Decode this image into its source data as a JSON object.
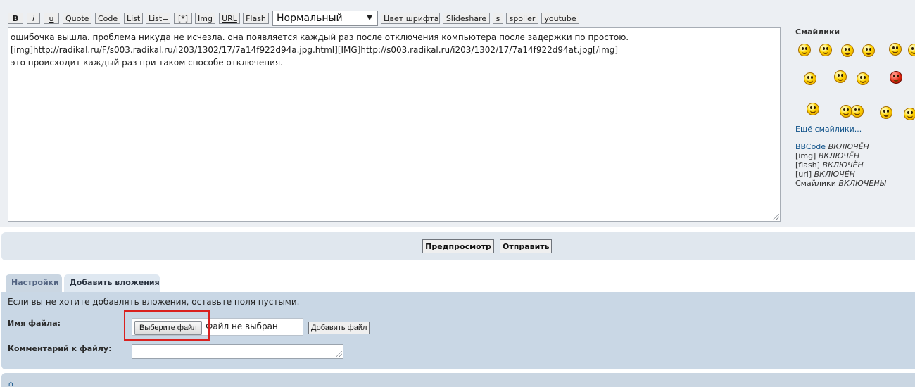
{
  "toolbar": {
    "buttons": [
      "B",
      "i",
      "u",
      "Quote",
      "Code",
      "List",
      "List=",
      "[*]",
      "Img",
      "URL",
      "Flash"
    ],
    "font_size_select": "Нормальный",
    "buttons_after": [
      "Цвет шрифта",
      "Slideshare",
      "s",
      "spoiler",
      "youtube"
    ]
  },
  "message": {
    "lines": [
      "ошибочка вышла. проблема никуда не исчезла. она появляется каждый раз после отключения компьютера после задержки по простою.",
      "[img]http://radikal.ru/F/s003.radikal.ru/i203/1302/17/7a14f922d94a.jpg.html][IMG]http://s003.radikal.ru/i203/1302/17/7a14f922d94at.jpg[/img]",
      "это происходит каждый раз при таком способе отключения."
    ]
  },
  "smilies": {
    "title": "Смайлики",
    "more_link": "Ещё смайлики...",
    "icons": [
      "smiley-icon",
      "smiley-icon",
      "grin-icon",
      "smiley-icon",
      "smiley-icon",
      "smiley-icon",
      "wave-icon",
      "blush-icon",
      "kiss-icon",
      "devil-icon",
      "smiley-icon",
      "crowd-icon",
      "crowd-icon",
      "angel-icon",
      "smiley-icon"
    ]
  },
  "bbcode_status": [
    {
      "label": "BBCode",
      "value": "ВКЛЮЧЁН"
    },
    {
      "label": "[img]",
      "value": "ВКЛЮЧЁН"
    },
    {
      "label": "[flash]",
      "value": "ВКЛЮЧЁН"
    },
    {
      "label": "[url]",
      "value": "ВКЛЮЧЁН"
    },
    {
      "label": "Смайлики",
      "value": "ВКЛЮЧЕНЫ"
    }
  ],
  "submit": {
    "preview": "Предпросмотр",
    "send": "Отправить"
  },
  "tabs": {
    "settings": "Настройки",
    "attachments": "Добавить вложения"
  },
  "attachments": {
    "note": "Если вы не хотите добавлять вложения, оставьте поля пустыми.",
    "filename_label": "Имя файла:",
    "choose_file": "Выберите файл",
    "no_file": "Файл не выбран",
    "add_file": "Добавить файл",
    "comment_label": "Комментарий к файлу:",
    "comment_value": ""
  },
  "colors": {
    "accent_link": "#105289",
    "highlight": "#d9211f",
    "panel": "#c9d7e5"
  }
}
